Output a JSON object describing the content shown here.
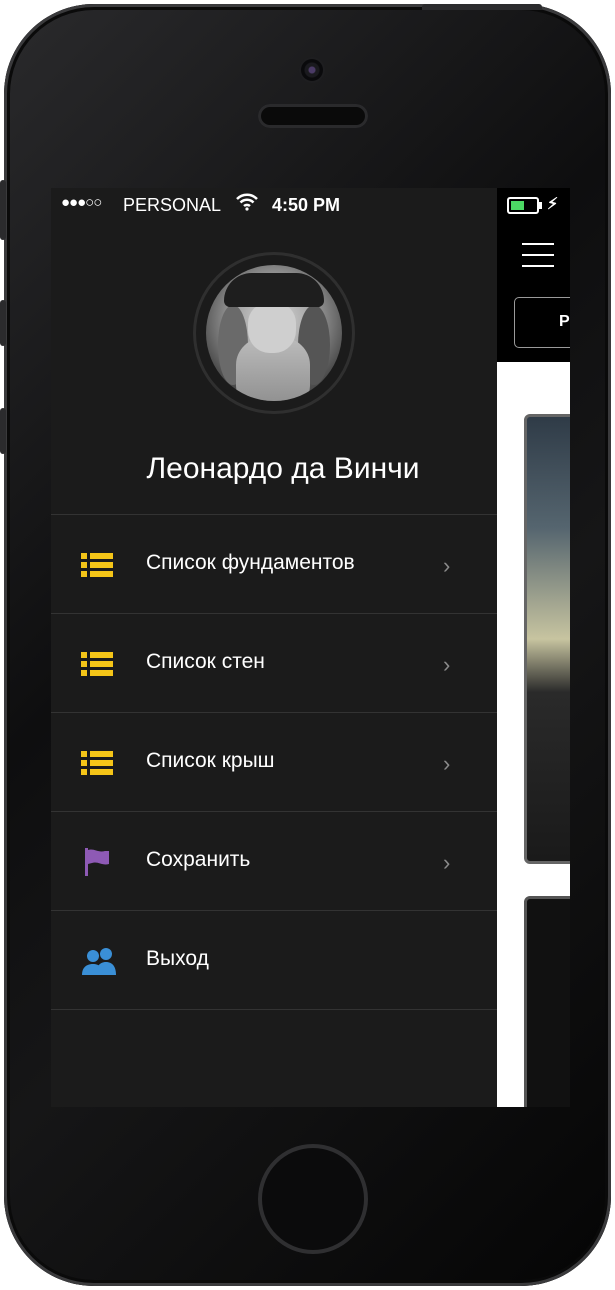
{
  "status_bar": {
    "signal": "●●●○○",
    "carrier": "PERSONAL",
    "time": "4:50 PM",
    "battery_level": 0.55
  },
  "profile": {
    "name": "Леонардо да Винчи"
  },
  "menu": {
    "items": [
      {
        "label": "Список фундаментов",
        "icon": "list-icon",
        "icon_color": "#f5c518",
        "has_chevron": true
      },
      {
        "label": "Список стен",
        "icon": "list-icon",
        "icon_color": "#f5c518",
        "has_chevron": true
      },
      {
        "label": "Список крыш",
        "icon": "list-icon",
        "icon_color": "#f5c518",
        "has_chevron": true
      },
      {
        "label": "Сохранить",
        "icon": "flag-icon",
        "icon_color": "#8e5ab5",
        "has_chevron": true
      },
      {
        "label": "Выход",
        "icon": "users-icon",
        "icon_color": "#3a8fd6",
        "has_chevron": false
      }
    ]
  },
  "content": {
    "tab_label_partial": "P"
  },
  "colors": {
    "drawer_bg": "#1b1b1b",
    "divider": "#333333",
    "battery": "#4cd964"
  }
}
